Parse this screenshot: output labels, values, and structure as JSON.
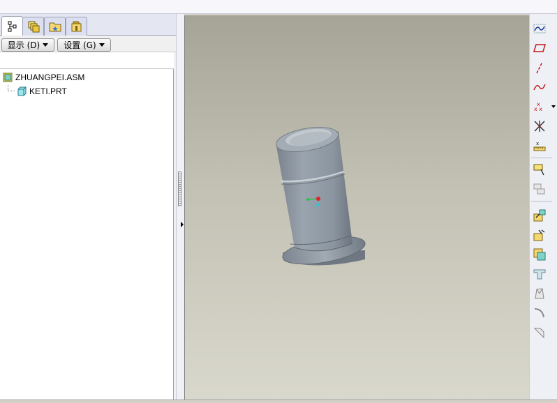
{
  "left_panel": {
    "tabs": [
      {
        "name": "model-tree-tab",
        "active": true
      },
      {
        "name": "layers-tab",
        "active": false
      },
      {
        "name": "favorites-tab",
        "active": false
      },
      {
        "name": "tools-tab",
        "active": false
      }
    ],
    "show_menu_label": "显示 (D)",
    "settings_menu_label": "设置 (G)",
    "tree": {
      "root_label": "ZHUANGPEI.ASM",
      "child_label": "KETI.PRT"
    }
  },
  "viewport": {
    "background_top": "#a6a497",
    "background_bottom": "#d9d8cc",
    "part_color": "#8f99a3"
  },
  "right_toolbar": {
    "icons": [
      "sketch-icon",
      "datum-plane-icon",
      "datum-axis-icon",
      "datum-curve-icon",
      "datum-point-icon",
      "coordinate-system-icon",
      "analysis-icon",
      "assemble-component-icon",
      "create-component-icon",
      "insert-feature-icon",
      "copy-component-icon",
      "pattern-icon",
      "hole-icon",
      "draft-icon",
      "round-icon",
      "chamfer-icon"
    ]
  }
}
